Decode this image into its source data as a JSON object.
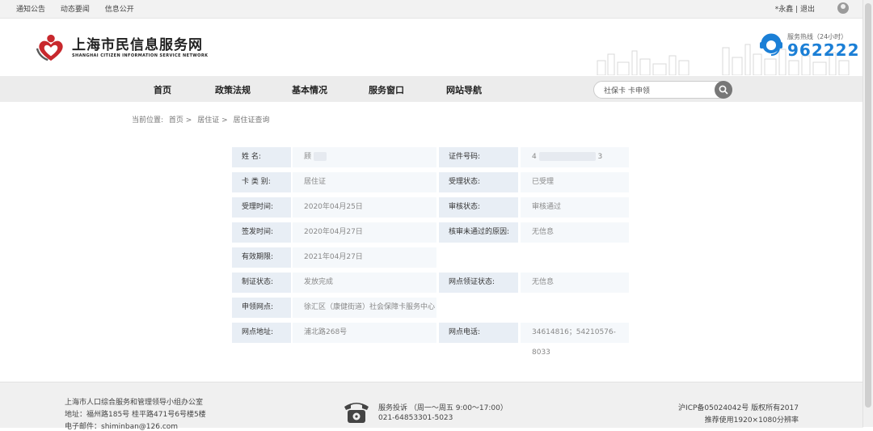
{
  "topbar": {
    "links": [
      "通知公告",
      "动态要闻",
      "信息公开"
    ],
    "user_text": "*永鑫 | 退出"
  },
  "header": {
    "title": "上海市民信息服务网",
    "subtitle": "SHANGHAI CITIZEN INFORMATION SERVICE NETWORK",
    "hotline_label": "服务热线（24小时）",
    "hotline_number": "962222"
  },
  "nav": {
    "items": [
      "首页",
      "政策法规",
      "基本情况",
      "服务窗口",
      "网站导航"
    ],
    "search_placeholder": "社保卡 卡申领"
  },
  "breadcrumb": {
    "prefix": "当前位置:",
    "items": [
      "首页 >",
      "居住证 >",
      "居住证查询"
    ]
  },
  "record": {
    "rows": [
      {
        "l1": "姓 名:",
        "v1": "顾",
        "l2": "证件号码:",
        "v2": "4",
        "v2_end": "3"
      },
      {
        "l1": "卡 类 别:",
        "v1": "居住证",
        "l2": "受理状态:",
        "v2": "已受理"
      },
      {
        "l1": "受理时间:",
        "v1": "2020年04月25日",
        "l2": "审核状态:",
        "v2": "审核通过"
      },
      {
        "l1": "签发时间:",
        "v1": "2020年04月27日",
        "l2": "核审未通过的原因:",
        "v2": "无信息"
      },
      {
        "l1": "有效期限:",
        "v1": "2021年04月27日"
      },
      {
        "l1": "制证状态:",
        "v1": "发放完成",
        "l2": "网点领证状态:",
        "v2": "无信息"
      },
      {
        "l1": "申领网点:",
        "v1": "徐汇区（康健街道）社会保障卡服务中心"
      },
      {
        "l1": "网点地址:",
        "v1": "浦北路268号",
        "l2": "网点电话:",
        "v2": "34614816；54210576-8033"
      }
    ]
  },
  "footer": {
    "org": "上海市人口综合服务和管理领导小组办公室",
    "address": "地址：福州路185号    桂平路471号6号楼5楼",
    "email": "电子邮件：shiminban@126.com",
    "complaint": "服务投诉  （周一～周五 9:00～17:00）",
    "complaint_phone": "021-64853301-5023",
    "icp": "沪ICP备05024042号 版权所有2017",
    "resolution": "推荐使用1920×1080分辨率"
  },
  "colors": {
    "brand_red": "#c8282d",
    "hotline_blue": "#1b7fd6",
    "label_bg": "#e8eef5",
    "value_bg": "#f5f8fb"
  }
}
